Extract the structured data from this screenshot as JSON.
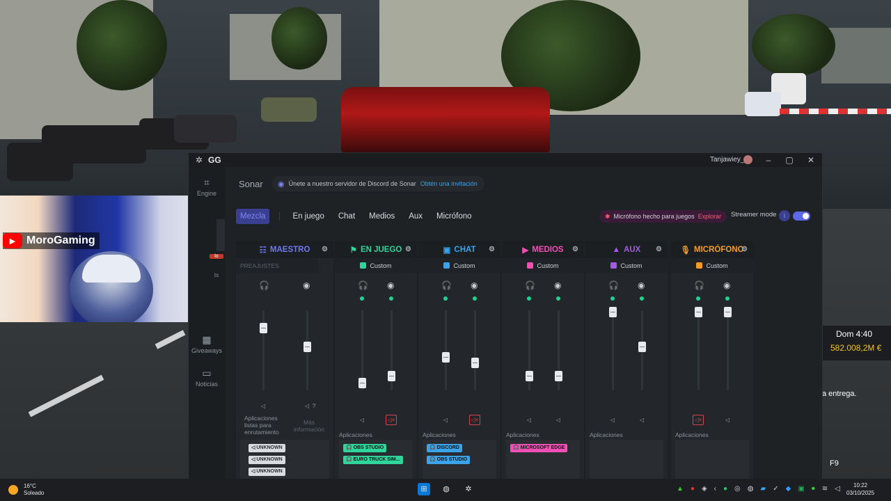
{
  "overlay": {
    "streamer_name": "MoroGaming",
    "hud_time": "Dom 4:40",
    "hud_money": "582.008,2M €",
    "delivery_text": "a entrega.",
    "key_hint": "F9"
  },
  "window": {
    "app_name": "GG",
    "user": "Tanjawiey_",
    "sidebar": [
      {
        "label": "Engine",
        "icon": "chip-icon"
      },
      {
        "label": "Giveaways",
        "icon": "gift-icon"
      },
      {
        "label": "Noticias",
        "icon": "news-icon"
      }
    ],
    "sidebar_badge": "lo",
    "sidebar_partial": "ts"
  },
  "sonar": {
    "title": "Sonar",
    "discord_text": "Únete a nuestro servidor de Discord de Sonar",
    "discord_link": "Obtén una invitación",
    "tabs": [
      "Mezcla",
      "En juego",
      "Chat",
      "Medios",
      "Aux",
      "Micrófono"
    ],
    "active_tab": "Mezcla",
    "promo_text": "Micrófono hecho para juegos",
    "promo_link": "Explorar",
    "streamer_mode": "Streamer mode",
    "streamer_mode_on": true,
    "info_label": "i"
  },
  "channels": [
    {
      "name": "MAESTRO",
      "color": "#6f78ee",
      "preset": "PREAJUSTES",
      "monitor_level": 0.78,
      "stream_level": 0.55,
      "apps_label": "Aplicaciones listas para enrutamiento",
      "more_info": "Más información",
      "apps": [
        "UNKNOWN",
        "UNKNOWN",
        "UNKNOWN"
      ]
    },
    {
      "name": "EN JUEGO",
      "color": "#2fd59a",
      "preset": "Custom",
      "monitor_level": 0.1,
      "stream_level": 0.18,
      "apps_label": "Aplicaciones",
      "apps": [
        "OBS STUDIO",
        "EURO TRUCK SIM..."
      ]
    },
    {
      "name": "CHAT",
      "color": "#3aa3ea",
      "preset": "Custom",
      "monitor_level": 0.42,
      "stream_level": 0.35,
      "apps_label": "Aplicaciones",
      "apps": [
        "DISCORD",
        "OBS STUDIO"
      ]
    },
    {
      "name": "MEDIOS",
      "color": "#f04fb6",
      "preset": "Custom",
      "monitor_level": 0.18,
      "stream_level": 0.18,
      "apps_label": "Aplicaciones",
      "apps": [
        "MICROSOFT EDGE"
      ]
    },
    {
      "name": "AUX",
      "color": "#a35ae6",
      "preset": "Custom",
      "monitor_level": 0.98,
      "stream_level": 0.55,
      "apps_label": "Aplicaciones",
      "apps": []
    },
    {
      "name": "MICRÓFONO",
      "color": "#f39c28",
      "preset": "Custom",
      "monitor_level": 0.98,
      "stream_level": 0.98,
      "apps_label": "Aplicaciones",
      "apps": []
    }
  ],
  "taskbar": {
    "temp": "16°C",
    "weather": "Soleado",
    "time": "10:22",
    "date": "03/10/2025"
  }
}
